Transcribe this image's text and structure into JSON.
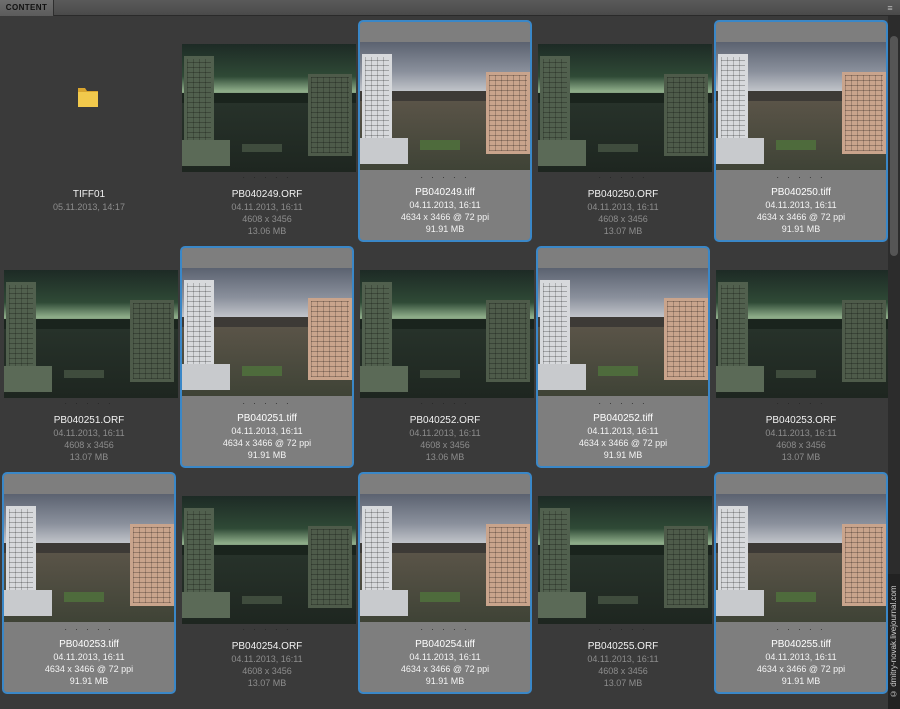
{
  "panel": {
    "tab_label": "CONTENT",
    "menu_icon": "panel-menu-icon"
  },
  "colors": {
    "selection": "#3a87c7",
    "selected_bg": "#7e7e7e",
    "panel_bg": "#3a3a3a"
  },
  "rating_placeholder": "· · · · ·",
  "items": [
    {
      "type": "folder",
      "name": "TIFF01",
      "lines": [
        "05.11.2013, 14:17"
      ],
      "selected": false
    },
    {
      "type": "orf",
      "name": "PB040249.ORF",
      "lines": [
        "04.11.2013, 16:11",
        "4608 x 3456",
        "13.06 MB"
      ],
      "selected": false
    },
    {
      "type": "tiff",
      "name": "PB040249.tiff",
      "lines": [
        "04.11.2013, 16:11",
        "4634 x 3466 @ 72 ppi",
        "91.91 MB"
      ],
      "selected": true
    },
    {
      "type": "orf",
      "name": "PB040250.ORF",
      "lines": [
        "04.11.2013, 16:11",
        "4608 x 3456",
        "13.07 MB"
      ],
      "selected": false
    },
    {
      "type": "tiff",
      "name": "PB040250.tiff",
      "lines": [
        "04.11.2013, 16:11",
        "4634 x 3466 @ 72 ppi",
        "91.91 MB"
      ],
      "selected": true
    },
    {
      "type": "orf",
      "name": "PB040251.ORF",
      "lines": [
        "04.11.2013, 16:11",
        "4608 x 3456",
        "13.07 MB"
      ],
      "selected": false
    },
    {
      "type": "tiff",
      "name": "PB040251.tiff",
      "lines": [
        "04.11.2013, 16:11",
        "4634 x 3466 @ 72 ppi",
        "91.91 MB"
      ],
      "selected": true
    },
    {
      "type": "orf",
      "name": "PB040252.ORF",
      "lines": [
        "04.11.2013, 16:11",
        "4608 x 3456",
        "13.06 MB"
      ],
      "selected": false
    },
    {
      "type": "tiff",
      "name": "PB040252.tiff",
      "lines": [
        "04.11.2013, 16:11",
        "4634 x 3466 @ 72 ppi",
        "91.91 MB"
      ],
      "selected": true
    },
    {
      "type": "orf",
      "name": "PB040253.ORF",
      "lines": [
        "04.11.2013, 16:11",
        "4608 x 3456",
        "13.07 MB"
      ],
      "selected": false
    },
    {
      "type": "tiff",
      "name": "PB040253.tiff",
      "lines": [
        "04.11.2013, 16:11",
        "4634 x 3466 @ 72 ppi",
        "91.91 MB"
      ],
      "selected": true
    },
    {
      "type": "orf",
      "name": "PB040254.ORF",
      "lines": [
        "04.11.2013, 16:11",
        "4608 x 3456",
        "13.07 MB"
      ],
      "selected": false
    },
    {
      "type": "tiff",
      "name": "PB040254.tiff",
      "lines": [
        "04.11.2013, 16:11",
        "4634 x 3466 @ 72 ppi",
        "91.91 MB"
      ],
      "selected": true
    },
    {
      "type": "orf",
      "name": "PB040255.ORF",
      "lines": [
        "04.11.2013, 16:11",
        "4608 x 3456",
        "13.07 MB"
      ],
      "selected": false
    },
    {
      "type": "tiff",
      "name": "PB040255.tiff",
      "lines": [
        "04.11.2013, 16:11",
        "4634 x 3466 @ 72 ppi",
        "91.91 MB"
      ],
      "selected": true
    }
  ],
  "watermark": "© dmitry-novak.livejournal.com"
}
